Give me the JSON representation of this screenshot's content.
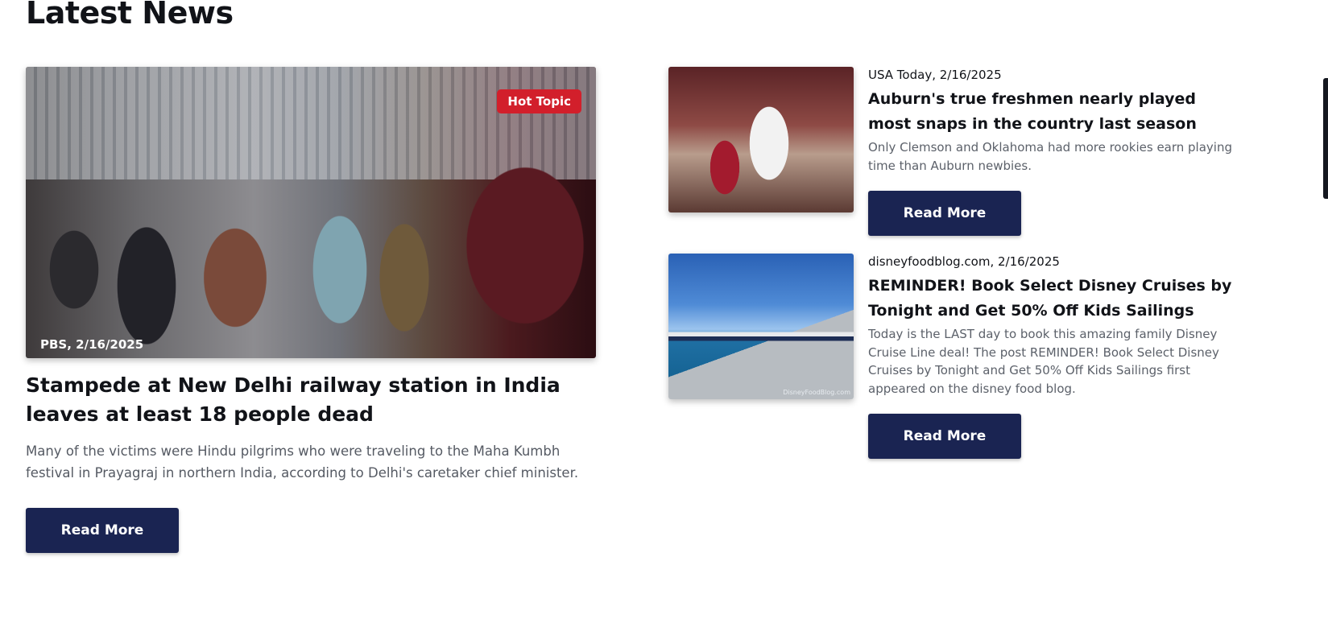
{
  "page": {
    "title": "Latest News"
  },
  "featured": {
    "badge": "Hot Topic",
    "source": "PBS, 2/16/2025",
    "title": "Stampede at New Delhi railway station in India leaves at least 18 people dead",
    "description": "Many of the victims were Hindu pilgrims who were traveling to the Maha Kumbh festival in Prayagraj in northern India, according to Delhi's caretaker chief minister.",
    "button_label": "Read More"
  },
  "articles": [
    {
      "source": "USA Today, 2/16/2025",
      "title": "Auburn's true freshmen nearly played most snaps in the country last season",
      "description": "Only Clemson and Oklahoma had more rookies earn playing time than Auburn newbies.",
      "button_label": "Read More"
    },
    {
      "source": "disneyfoodblog.com, 2/16/2025",
      "title": "REMINDER! Book Select Disney Cruises by Tonight and Get 50% Off Kids Sailings",
      "description": "Today is the LAST day to book this amazing family Disney Cruise Line deal! The post REMINDER! Book Select Disney Cruises by Tonight and Get 50% Off Kids Sailings first appeared on the disney food blog.",
      "image_watermark": "DisneyFoodBlog.com",
      "button_label": "Read More"
    }
  ],
  "colors": {
    "button_bg": "#1a2452",
    "badge_bg": "#d21f2b",
    "text": "#111318",
    "muted_text": "#555a63"
  }
}
